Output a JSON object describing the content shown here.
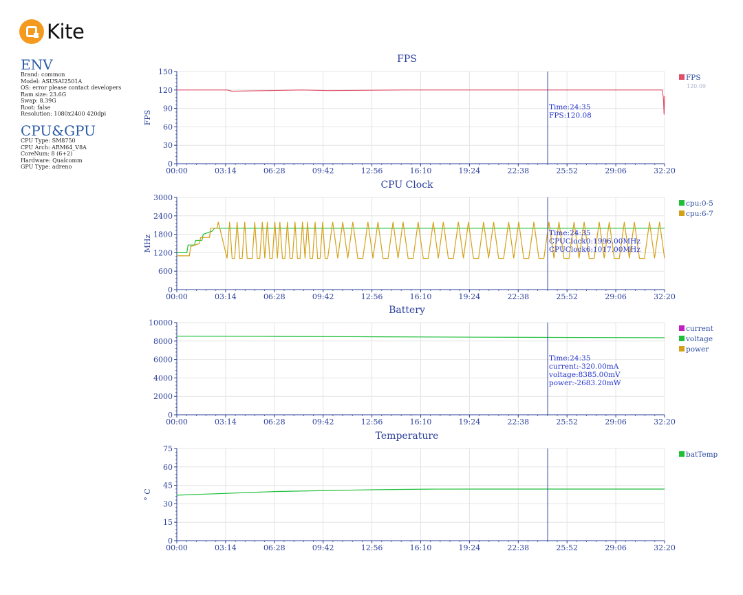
{
  "app": {
    "logo_text": "Kite",
    "brand_color": "#f39a1f"
  },
  "env": {
    "title": "ENV",
    "rows": [
      "Brand: common",
      "Model: ASUSAI2501A",
      "OS: error please contact developers",
      "Ram size: 23.6G",
      "Swap: 8.39G",
      "Root: false",
      "Resolution: 1080x2400 420dpi"
    ]
  },
  "cpugpu": {
    "title": "CPU&GPU",
    "rows": [
      "CPU Type: SM8750",
      "CPU Arch: ARM64_V8A",
      "CoreNum: 8 (6+2)",
      "Hardware: Qualcomm",
      "GPU Type: adreno"
    ]
  },
  "chart_data": [
    {
      "type": "line",
      "title": "FPS",
      "ylabel": "FPS",
      "ylim": [
        0,
        150
      ],
      "yticks": [
        0,
        30,
        60,
        90,
        120,
        150
      ],
      "x_ticks": [
        "00:00",
        "03:14",
        "06:28",
        "09:42",
        "12:56",
        "16:10",
        "19:24",
        "22:38",
        "25:52",
        "29:06",
        "32:20"
      ],
      "x_unit": "seconds",
      "x_range": [
        0,
        1940
      ],
      "cursor": {
        "x": 1475,
        "lines": [
          "Time:24:35",
          "FPS:120.08"
        ]
      },
      "legend_position": "right",
      "series": [
        {
          "name": "FPS",
          "color": "#e0506a",
          "legend_value": "120.09",
          "x": [
            0,
            200,
            220,
            500,
            600,
            900,
            1200,
            1500,
            1700,
            1900,
            1930,
            1935,
            1938,
            1940
          ],
          "values": [
            120,
            120,
            118,
            120,
            119,
            120,
            120,
            120,
            120,
            120,
            120,
            108,
            80,
            110
          ]
        }
      ]
    },
    {
      "type": "line",
      "title": "CPU Clock",
      "ylabel": "MHz",
      "ylim": [
        0,
        3000
      ],
      "yticks": [
        0,
        600,
        1200,
        1800,
        2400,
        3000
      ],
      "x_ticks": [
        "00:00",
        "03:14",
        "06:28",
        "09:42",
        "12:56",
        "16:10",
        "19:24",
        "22:38",
        "25:52",
        "29:06",
        "32:20"
      ],
      "x_unit": "seconds",
      "x_range": [
        0,
        1940
      ],
      "cursor": {
        "x": 1475,
        "lines": [
          "Time:24:35",
          "CPUClock0:1996.00MHz",
          "CPUClock6:1017.00MHz"
        ]
      },
      "legend_position": "right",
      "series": [
        {
          "name": "cpu:0-5",
          "color": "#1fbf3a",
          "x": [
            0,
            40,
            45,
            70,
            75,
            100,
            105,
            140,
            150,
            1940
          ],
          "values": [
            1200,
            1200,
            1450,
            1450,
            1600,
            1600,
            1800,
            1900,
            1996,
            1996
          ]
        },
        {
          "name": "cpu:6-7",
          "color": "#d4a017",
          "x": [
            0,
            50,
            55,
            90,
            95,
            130,
            135,
            160,
            165,
            200,
            210,
            220,
            230,
            240,
            250,
            260,
            270,
            280,
            290,
            300,
            310,
            320,
            330,
            340,
            350,
            360,
            370,
            380,
            390,
            400,
            410,
            420,
            430,
            440,
            450,
            460,
            470,
            480,
            490,
            500,
            510,
            520,
            530,
            540,
            550,
            560,
            570,
            580,
            590,
            600,
            620,
            640,
            660,
            680,
            700,
            720,
            740,
            760,
            780,
            800,
            820,
            840,
            860,
            880,
            900,
            920,
            940,
            960,
            980,
            1000,
            1020,
            1040,
            1060,
            1080,
            1100,
            1120,
            1140,
            1160,
            1180,
            1200,
            1220,
            1240,
            1260,
            1280,
            1300,
            1320,
            1340,
            1360,
            1380,
            1400,
            1420,
            1440,
            1460,
            1480,
            1500,
            1520,
            1540,
            1560,
            1580,
            1600,
            1620,
            1640,
            1660,
            1680,
            1700,
            1720,
            1740,
            1760,
            1780,
            1800,
            1820,
            1840,
            1860,
            1880,
            1900,
            1920,
            1940
          ],
          "values": [
            1100,
            1100,
            1400,
            1500,
            1700,
            1700,
            2000,
            2000,
            2200,
            1017,
            2200,
            1017,
            1017,
            2200,
            1017,
            1017,
            2200,
            1017,
            1017,
            1017,
            2200,
            1017,
            1017,
            2200,
            1017,
            2200,
            1017,
            1017,
            2200,
            1017,
            2200,
            1017,
            1017,
            2200,
            1017,
            1017,
            2200,
            1017,
            1017,
            2200,
            1017,
            2200,
            1017,
            1017,
            2200,
            1017,
            1017,
            2200,
            1017,
            1017,
            2200,
            1017,
            2200,
            1017,
            2200,
            1017,
            1017,
            2200,
            1017,
            2200,
            1017,
            1017,
            2200,
            1017,
            2200,
            1017,
            1017,
            2200,
            1017,
            1017,
            2200,
            1017,
            2200,
            1017,
            1017,
            2200,
            1017,
            2200,
            1017,
            1017,
            2200,
            1017,
            2200,
            1017,
            1017,
            2200,
            1017,
            2200,
            1017,
            1017,
            2200,
            1017,
            1017,
            2200,
            1017,
            2200,
            1017,
            1017,
            2200,
            1017,
            2200,
            1017,
            1017,
            2200,
            1017,
            2200,
            1017,
            1017,
            2200,
            1017,
            2200,
            1017,
            1017,
            2200,
            1017,
            2200,
            1017
          ]
        }
      ]
    },
    {
      "type": "line",
      "title": "Battery",
      "ylabel": "",
      "ylim": [
        0,
        10000
      ],
      "yticks": [
        0,
        2000,
        4000,
        6000,
        8000,
        10000
      ],
      "x_ticks": [
        "00:00",
        "03:14",
        "06:28",
        "09:42",
        "12:56",
        "16:10",
        "19:24",
        "22:38",
        "25:52",
        "29:06",
        "32:20"
      ],
      "x_unit": "seconds",
      "x_range": [
        0,
        1940
      ],
      "cursor": {
        "x": 1475,
        "lines": [
          "Time:24:35",
          "current:-320.00mA",
          "voltage:8385.00mV",
          "power:-2683.20mW"
        ]
      },
      "legend_position": "right",
      "series": [
        {
          "name": "current",
          "color": "#c020c0",
          "x": [],
          "values": []
        },
        {
          "name": "voltage",
          "color": "#1fbf3a",
          "x": [
            0,
            400,
            800,
            1200,
            1600,
            1940
          ],
          "values": [
            8520,
            8500,
            8460,
            8420,
            8385,
            8360
          ]
        },
        {
          "name": "power",
          "color": "#d4a017",
          "x": [],
          "values": []
        }
      ]
    },
    {
      "type": "line",
      "title": "Temperature",
      "ylabel": "° C",
      "ylim": [
        0,
        75
      ],
      "yticks": [
        0,
        15,
        30,
        45,
        60,
        75
      ],
      "x_ticks": [
        "00:00",
        "03:14",
        "06:28",
        "09:42",
        "12:56",
        "16:10",
        "19:24",
        "22:38",
        "25:52",
        "29:06",
        "32:20"
      ],
      "x_unit": "seconds",
      "x_range": [
        0,
        1940
      ],
      "cursor": {
        "x": 1475,
        "lines": []
      },
      "legend_position": "right",
      "series": [
        {
          "name": "batTemp",
          "color": "#1fbf3a",
          "x": [
            0,
            200,
            400,
            600,
            800,
            1000,
            1200,
            1400,
            1600,
            1800,
            1940
          ],
          "values": [
            37,
            38.5,
            40,
            40.8,
            41.5,
            41.9,
            42,
            42,
            42,
            42,
            42
          ]
        }
      ]
    }
  ]
}
